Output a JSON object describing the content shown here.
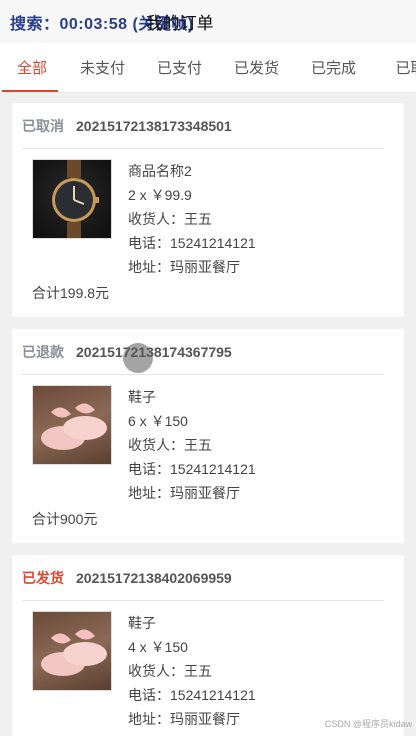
{
  "header": {
    "overlay": "搜索：00:03:58 (关键帧)",
    "title": "我的订单"
  },
  "tabs": [
    {
      "label": "全部",
      "active": true
    },
    {
      "label": "未支付",
      "active": false
    },
    {
      "label": "已支付",
      "active": false
    },
    {
      "label": "已发货",
      "active": false
    },
    {
      "label": "已完成",
      "active": false
    },
    {
      "label": "已取",
      "active": false
    }
  ],
  "orders": [
    {
      "status": "已取消",
      "order_no": "20215172138173348501",
      "product_name": "商品名称2",
      "qty_price": "2 x ￥99.9",
      "receiver": "收货人：王五",
      "phone": "电话：15241214121",
      "address": "地址：玛丽亚餐厅",
      "total": "合计199.8元",
      "image": "watch"
    },
    {
      "status": "已退款",
      "order_no": "20215172138174367795",
      "product_name": "鞋子",
      "qty_price": "6 x ￥150",
      "receiver": "收货人：王五",
      "phone": "电话：15241214121",
      "address": "地址：玛丽亚餐厅",
      "total": "合计900元",
      "image": "shoes"
    },
    {
      "status": "已发货",
      "order_no": "20215172138402069959",
      "product_name": "鞋子",
      "qty_price": "4 x ￥150",
      "receiver": "收货人：王五",
      "phone": "电话：15241214121",
      "address": "地址：玛丽亚餐厅",
      "total": "",
      "image": "shoes"
    }
  ],
  "watermark": "CSDN @程序员kidaw",
  "colors": {
    "accent": "#d8472d",
    "status_gray": "#8a8f99"
  }
}
